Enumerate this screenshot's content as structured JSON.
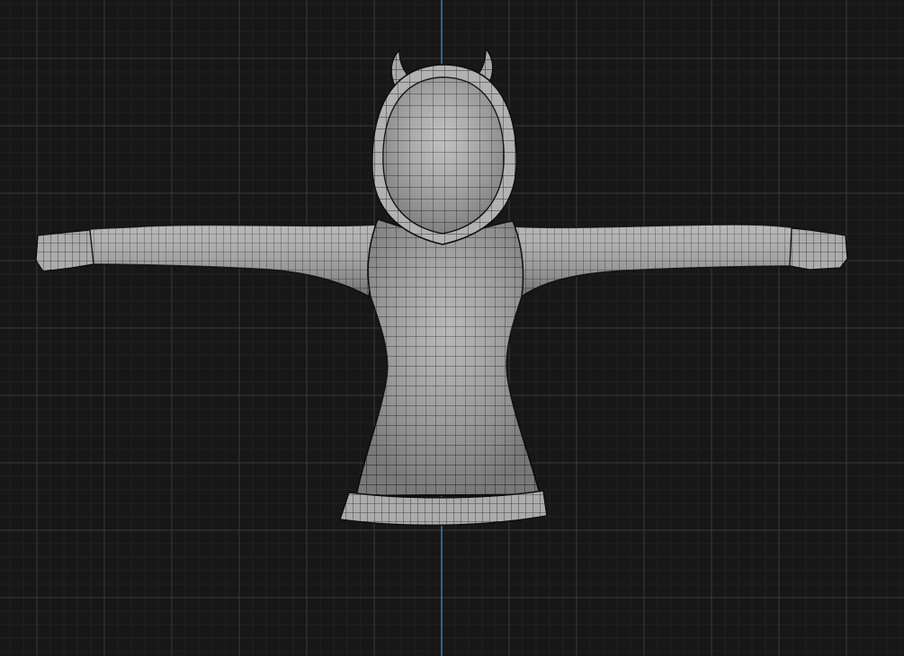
{
  "viewport": {
    "view": "front-orthographic",
    "background_color": "#171717",
    "grid": {
      "visible": true,
      "minor_color": "#202020",
      "major_color": "#3a3a3a",
      "vertical_axis_color": "#4a94c8"
    },
    "model": {
      "description_icon": "hoodie-mesh",
      "display_mode": "wireframe-on-shaded",
      "surface_color": "#a9a9a9",
      "wire_color": "#2a2a2a",
      "outline_color": "#0e0e0e",
      "horns": 2
    }
  }
}
